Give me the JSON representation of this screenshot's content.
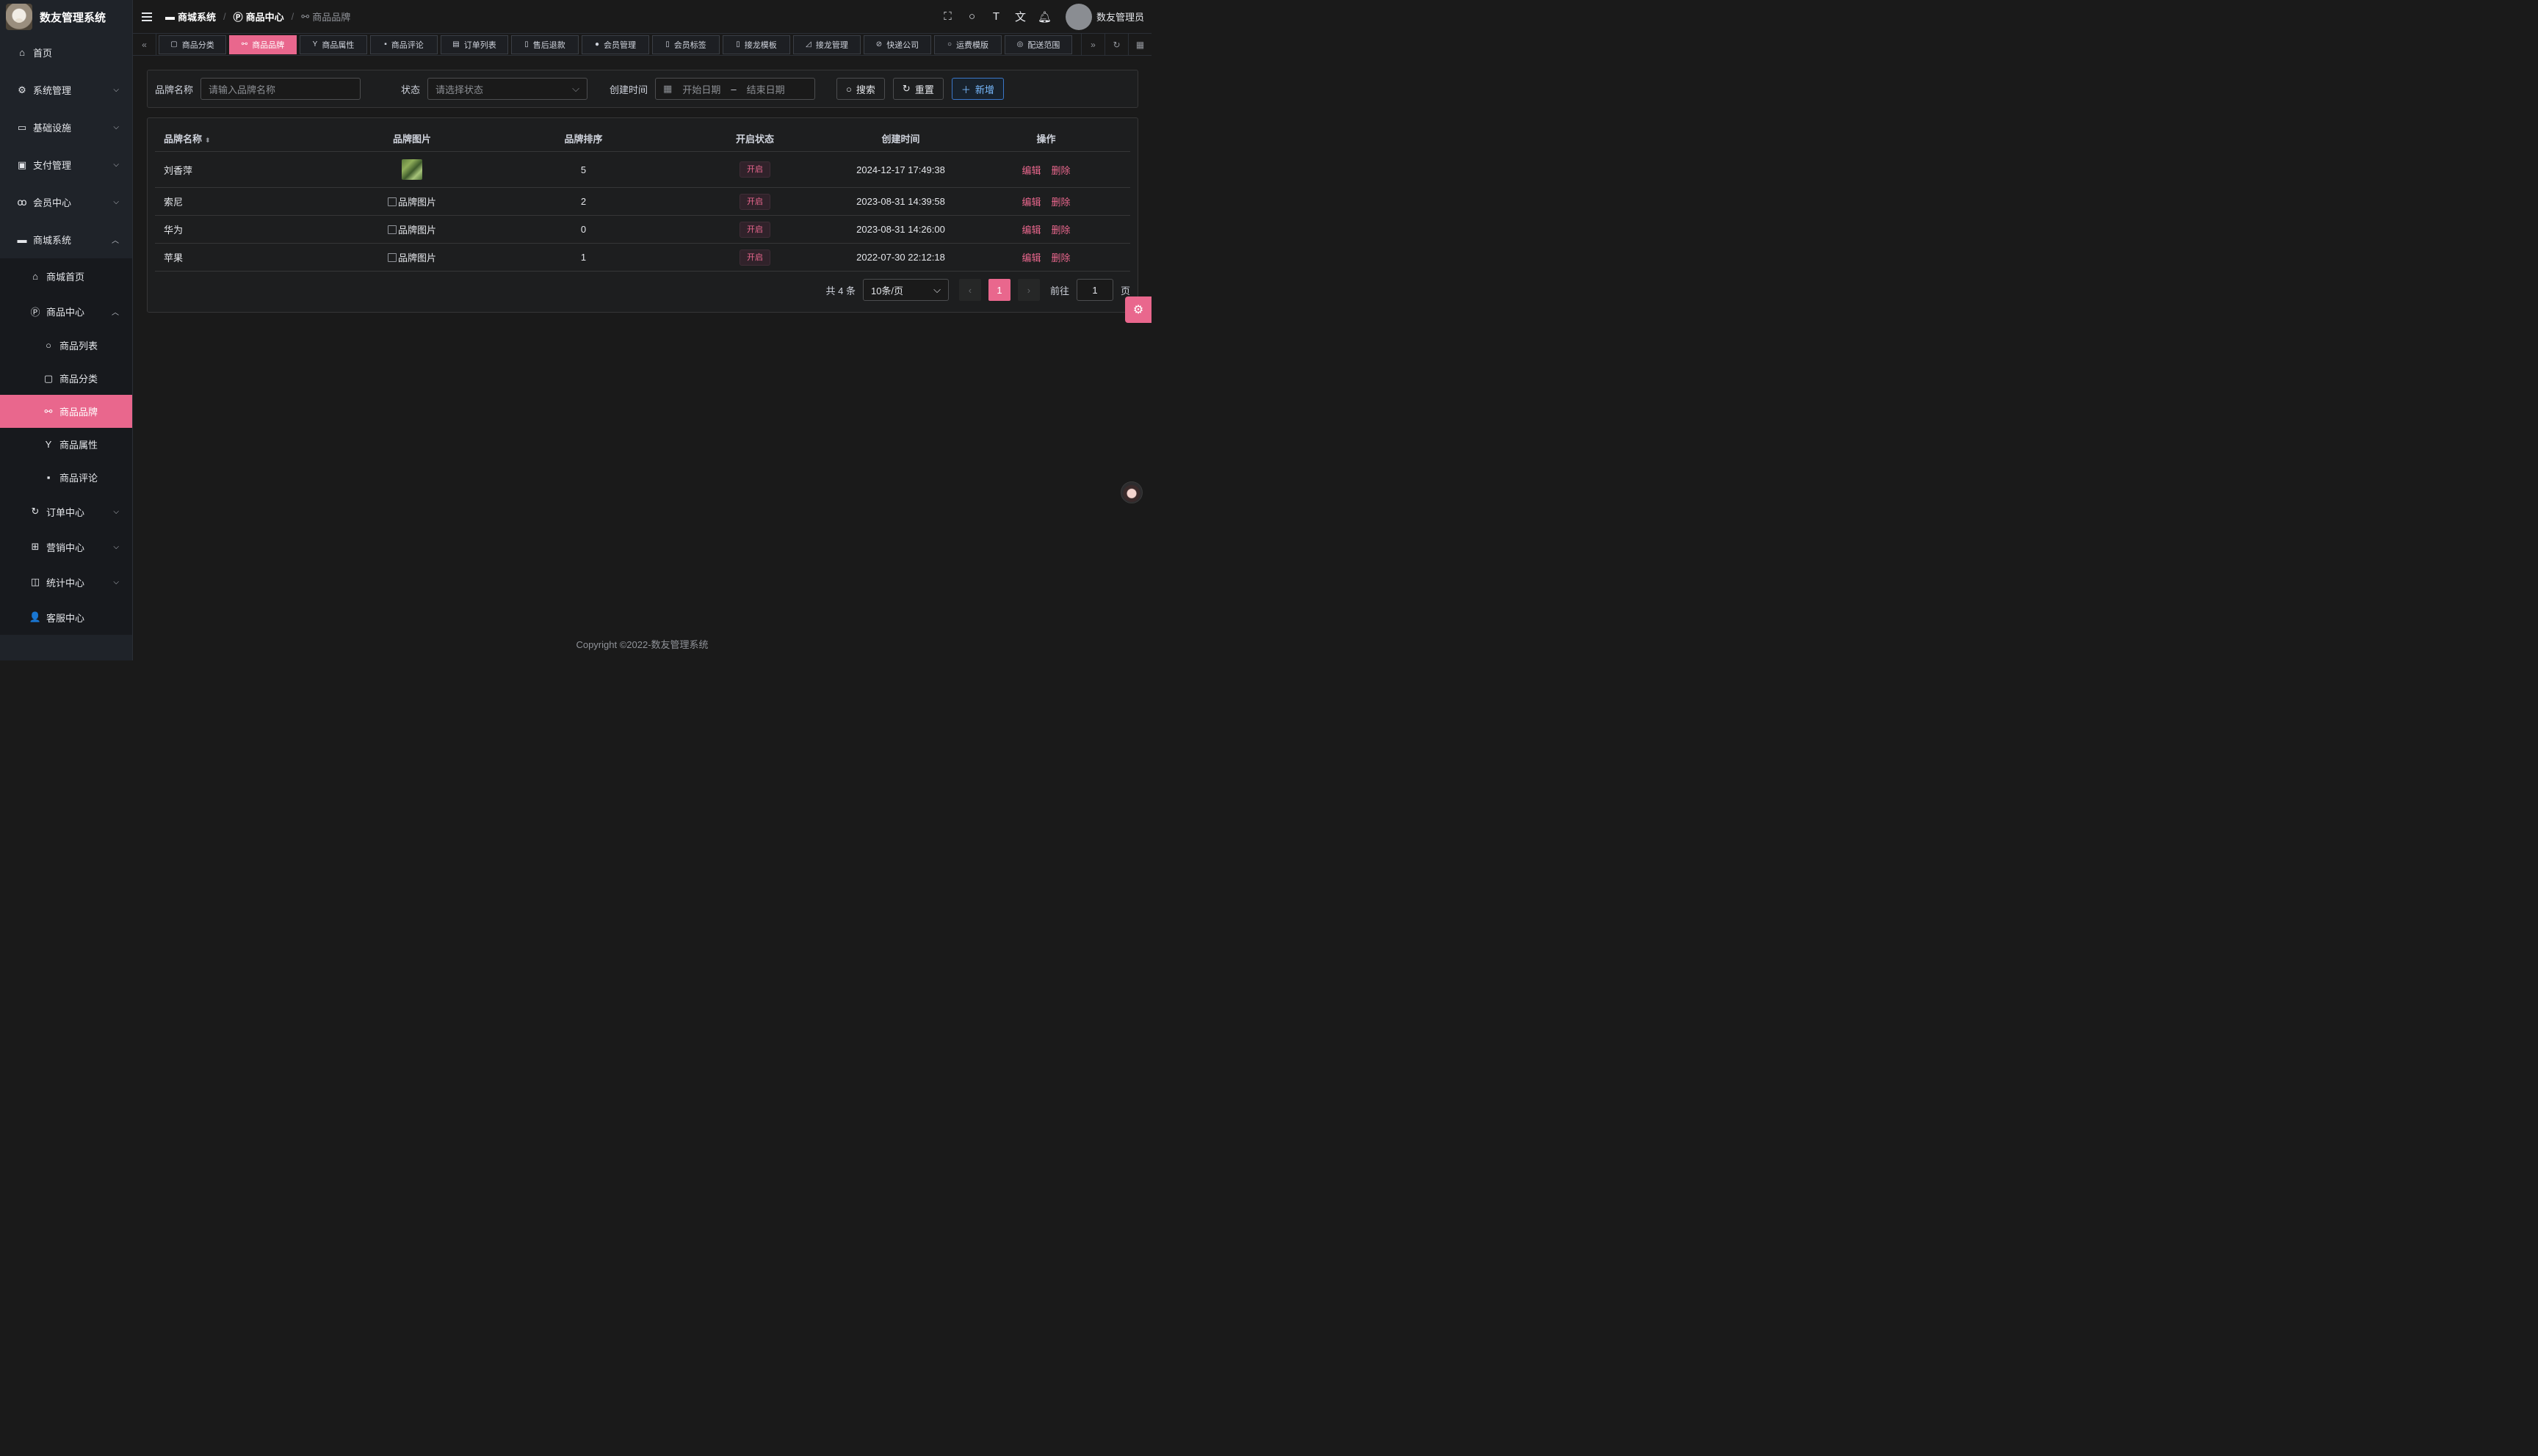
{
  "app": {
    "title": "数友管理系统"
  },
  "sidebar": {
    "items": [
      {
        "label": "首页"
      },
      {
        "label": "系统管理"
      },
      {
        "label": "基础设施"
      },
      {
        "label": "支付管理"
      },
      {
        "label": "会员中心"
      },
      {
        "label": "商城系统"
      }
    ],
    "mall": {
      "items": [
        {
          "label": "商城首页"
        },
        {
          "label": "商品中心"
        }
      ],
      "goods": [
        {
          "label": "商品列表"
        },
        {
          "label": "商品分类"
        },
        {
          "label": "商品品牌"
        },
        {
          "label": "商品属性"
        },
        {
          "label": "商品评论"
        }
      ],
      "more": [
        {
          "label": "订单中心"
        },
        {
          "label": "营销中心"
        },
        {
          "label": "统计中心"
        },
        {
          "label": "客服中心"
        }
      ]
    }
  },
  "header": {
    "breadcrumb": [
      "商城系统",
      "商品中心",
      "商品品牌"
    ],
    "user": "数友管理员"
  },
  "tabs": [
    "商品分类",
    "商品品牌",
    "商品属性",
    "商品评论",
    "订单列表",
    "售后退款",
    "会员管理",
    "会员标签",
    "接龙模板",
    "接龙管理",
    "快递公司",
    "运费模版",
    "配送范围"
  ],
  "search": {
    "brand_label": "品牌名称",
    "brand_placeholder": "请输入品牌名称",
    "status_label": "状态",
    "status_placeholder": "请选择状态",
    "time_label": "创建时间",
    "start_placeholder": "开始日期",
    "range_sep": "–",
    "end_placeholder": "结束日期",
    "search_btn": "搜索",
    "reset_btn": "重置",
    "add_btn": "新增"
  },
  "table": {
    "headers": [
      "品牌名称",
      "品牌图片",
      "品牌排序",
      "开启状态",
      "创建时间",
      "操作"
    ],
    "rows": [
      {
        "name": "刘香萍",
        "image": "",
        "sort": "5",
        "status": "开启",
        "time": "2024-12-17 17:49:38"
      },
      {
        "name": "索尼",
        "image": "品牌图片",
        "sort": "2",
        "status": "开启",
        "time": "2023-08-31 14:39:58"
      },
      {
        "name": "华为",
        "image": "品牌图片",
        "sort": "0",
        "status": "开启",
        "time": "2023-08-31 14:26:00"
      },
      {
        "name": "苹果",
        "image": "品牌图片",
        "sort": "1",
        "status": "开启",
        "time": "2022-07-30 22:12:18"
      }
    ],
    "edit": "编辑",
    "delete": "删除"
  },
  "pagination": {
    "total": "共 4 条",
    "page_size": "10条/页",
    "current": "1",
    "goto_label": "前往",
    "goto_value": "1",
    "goto_suffix": "页"
  },
  "footer": "Copyright ©2022-数友管理系统",
  "colors": {
    "accent": "#e9678d",
    "bg": "#1a1a1a",
    "sidebar": "#1f2329"
  }
}
